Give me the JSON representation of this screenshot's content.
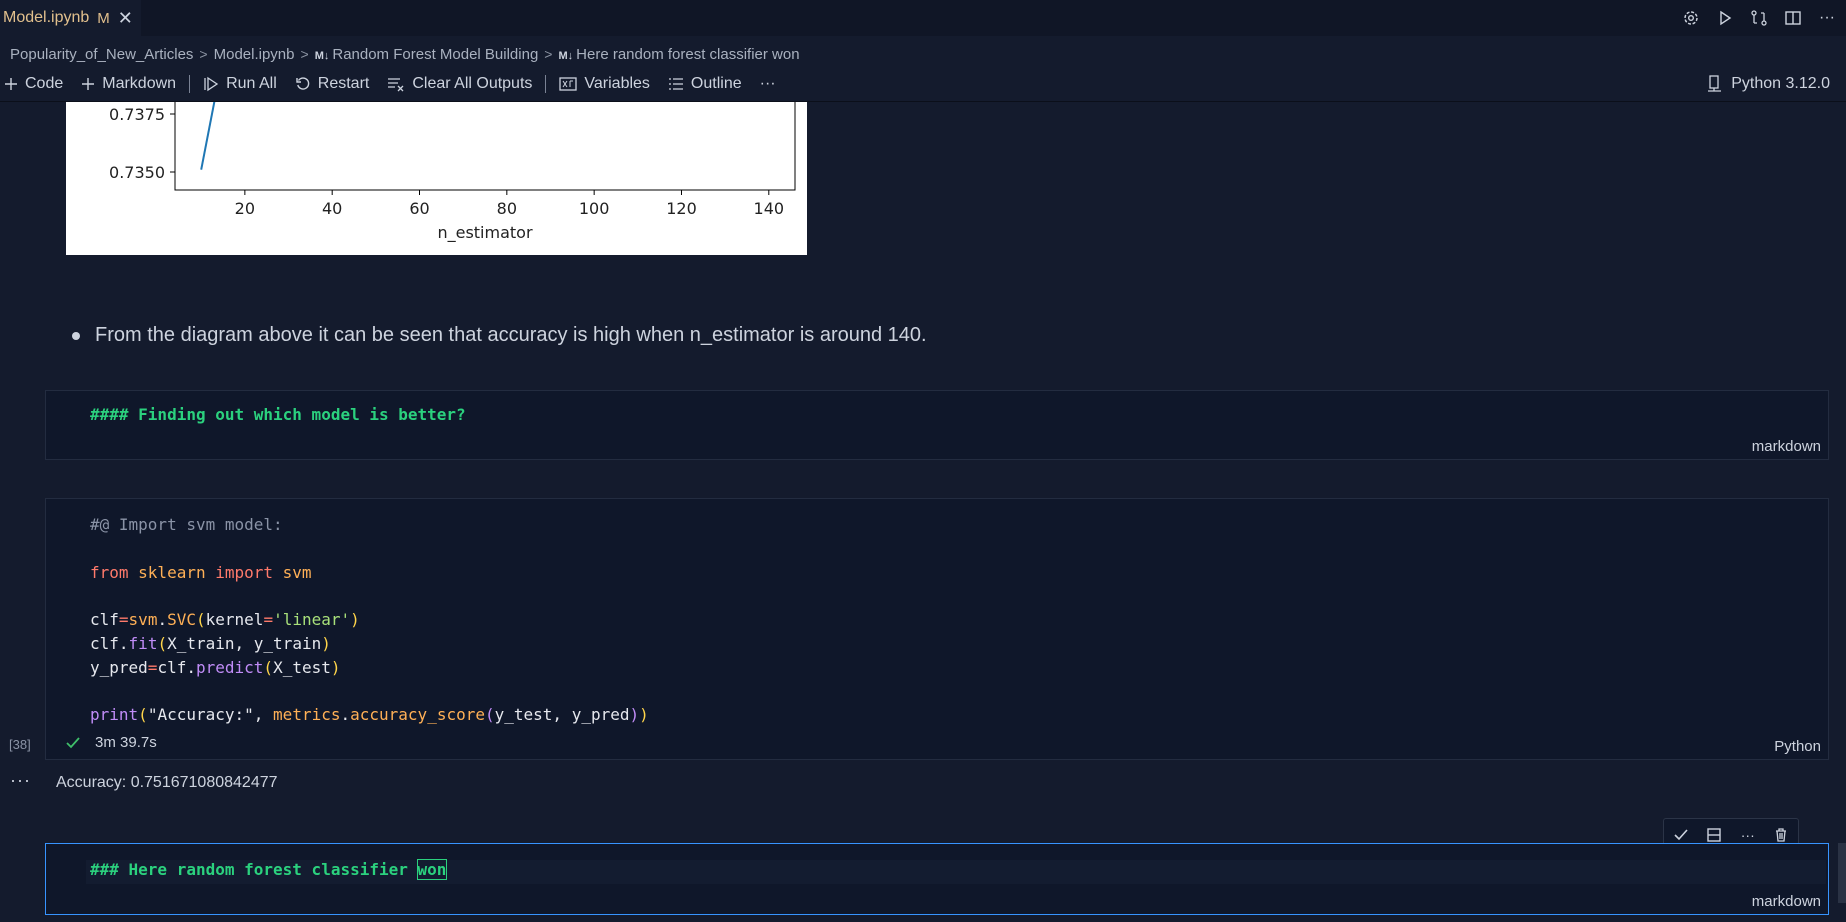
{
  "tab": {
    "label": "Model.ipynb",
    "modified": "M"
  },
  "breadcrumb": [
    {
      "label": "Popularity_of_New_Articles",
      "badge": ""
    },
    {
      "label": "Model.ipynb",
      "badge": ""
    },
    {
      "label": "Random Forest Model Building",
      "badge": "M↓"
    },
    {
      "label": "Here random forest classifier won",
      "badge": "M↓"
    }
  ],
  "toolbar": {
    "code": "Code",
    "markdown": "Markdown",
    "run_all": "Run All",
    "restart": "Restart",
    "clear_outputs": "Clear All Outputs",
    "variables": "Variables",
    "outline": "Outline",
    "more": "···",
    "kernel": "Python 3.12.0"
  },
  "chart_data": {
    "type": "line",
    "xlabel": "n_estimator",
    "ylabel": "",
    "x_ticks": [
      20,
      40,
      60,
      80,
      100,
      120,
      140
    ],
    "y_ticks_visible": [
      "0.7375",
      "0.7350"
    ],
    "xlim": [
      4,
      146
    ],
    "ylim_visible": [
      0.7346,
      0.7385
    ],
    "series": [
      {
        "x": [
          10,
          13.5
        ],
        "y": [
          0.7351,
          0.7385
        ]
      }
    ],
    "color": "#1f77b4",
    "grid": false
  },
  "markdown_output": {
    "bullet": "From the diagram above it can be seen that accuracy is high when n_estimator is around 140."
  },
  "cells": {
    "heading_cell": {
      "text": "#### Finding out which model is better?",
      "lang": "markdown"
    },
    "code_cell": {
      "comment": "#@ Import svm model:",
      "exec_count": "[38]",
      "exec_time": "3m 39.7s",
      "lang": "Python",
      "output": "Accuracy: 0.751671080842477",
      "lines": {
        "l1_from": "from",
        "l1_mod": " sklearn ",
        "l1_import": "import",
        "l1_name": " svm",
        "l2_clf": "clf",
        "l2_eq": "=",
        "l2_svm": "svm",
        "l2_dot": ".",
        "l2_svc": "SVC",
        "l2_lp": "(",
        "l2_arg": "kernel",
        "l2_eq2": "=",
        "l2_str": "'linear'",
        "l2_rp": ")",
        "l3_clf": "clf",
        "l3_dot": ".",
        "l3_fit": "fit",
        "l3_lp": "(",
        "l3_args": "X_train, y_train",
        "l3_rp": ")",
        "l4_ypred": "y_pred",
        "l4_eq": "=",
        "l4_clf": "clf",
        "l4_dot": ".",
        "l4_predict": "predict",
        "l4_lp": "(",
        "l4_args": "X_test",
        "l4_rp": ")",
        "l5_print": "print",
        "l5_lp": "(",
        "l5_str": "\"Accuracy:\"",
        "l5_comma": ", ",
        "l5_metrics": "metrics",
        "l5_dot": ".",
        "l5_fn": "accuracy_score",
        "l5_lp2": "(",
        "l5_args": "y_test, y_pred",
        "l5_rp2": ")",
        "l5_rp": ")"
      }
    },
    "active_cell": {
      "text_before": "### Here random forest classifier ",
      "text_word": "won",
      "lang": "markdown"
    }
  },
  "icons": {
    "close": "close-icon",
    "settings": "gear-icon",
    "run": "play-icon",
    "compare": "compare-changes-icon",
    "split": "split-editor-icon",
    "more": "ellipsis-icon",
    "kernel": "kernel-icon"
  }
}
